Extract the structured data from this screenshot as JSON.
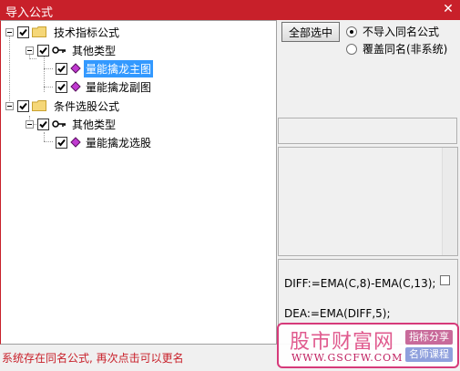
{
  "window": {
    "title": "导入公式",
    "close_glyph": "✕"
  },
  "tree": {
    "group1": {
      "label": "技术指标公式",
      "subgroup": {
        "label": "其他类型",
        "items": [
          "量能擒龙主图",
          "量能擒龙副图"
        ]
      }
    },
    "group2": {
      "label": "条件选股公式",
      "subgroup": {
        "label": "其他类型",
        "items": [
          "量能擒龙选股"
        ]
      }
    }
  },
  "options": {
    "select_all_label": "全部选中",
    "radio_skip_label": "不导入同名公式",
    "radio_overwrite_label": "覆盖同名(非系统)",
    "selected": "skip"
  },
  "formula_preview": {
    "line1": "DIFF:=EMA(C,8)-EMA(C,13);",
    "line2": "DEA:=EMA(DIFF,5);"
  },
  "status_text": "系统存在同名公式, 再次点击可以更名",
  "watermark": {
    "brand": "股市财富网",
    "url": "WWW.GSCFW.COM",
    "tag1": "指标分享",
    "tag2": "名师课程"
  },
  "colors": {
    "accent": "#c8202a",
    "selection": "#3399ff",
    "watermark": "#e05a8e"
  }
}
